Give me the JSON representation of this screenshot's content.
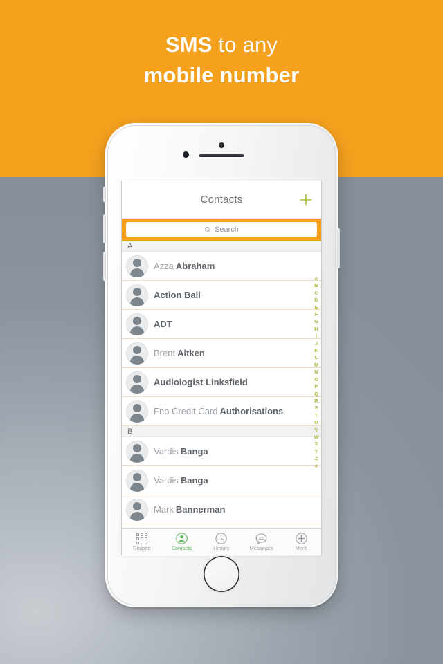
{
  "promo": {
    "line1_strong": "SMS",
    "line1_rest": " to any",
    "line2": "mobile number",
    "band_color": "#f5a11e",
    "text_color": "#ffffff"
  },
  "device": {
    "type": "white-smartphone",
    "camera_icon": "front-camera",
    "earpiece_icon": "earpiece-speaker",
    "sensor_icon": "proximity-sensor",
    "home_button_icon": "home-button"
  },
  "app": {
    "navbar": {
      "title": "Contacts",
      "add_icon": "plus-icon",
      "add_icon_color": "#aec043"
    },
    "search": {
      "placeholder": "Search",
      "value": "",
      "icon": "search-icon",
      "highlight_color": "#f5a11e"
    },
    "sections": [
      {
        "letter": "A",
        "contacts": [
          {
            "first": "Azza",
            "last": "Abraham",
            "avatar_icon": "person-avatar"
          },
          {
            "first": "",
            "last": "Action Ball",
            "avatar_icon": "person-avatar"
          },
          {
            "first": "",
            "last": "ADT",
            "avatar_icon": "person-avatar"
          },
          {
            "first": "Brent",
            "last": "Aitken",
            "avatar_icon": "person-avatar"
          },
          {
            "first": "",
            "last": "Audiologist Linksfield",
            "avatar_icon": "person-avatar"
          },
          {
            "first": "Fnb Credit Card",
            "last": "Authorisations",
            "avatar_icon": "person-avatar"
          }
        ]
      },
      {
        "letter": "B",
        "contacts": [
          {
            "first": "Vardis",
            "last": "Banga",
            "avatar_icon": "person-avatar"
          },
          {
            "first": "Vardis",
            "last": "Banga",
            "avatar_icon": "person-avatar"
          },
          {
            "first": "Mark",
            "last": "Bannerman",
            "avatar_icon": "person-avatar"
          }
        ]
      }
    ],
    "alpha_index": [
      "A",
      "B",
      "C",
      "D",
      "E",
      "F",
      "G",
      "H",
      "I",
      "J",
      "K",
      "L",
      "M",
      "N",
      "O",
      "P",
      "Q",
      "R",
      "S",
      "T",
      "U",
      "V",
      "W",
      "X",
      "Y",
      "Z",
      "#"
    ],
    "alpha_index_color": "#aec043",
    "tabs": [
      {
        "label": "Dialpad",
        "icon": "dialpad-icon",
        "active": false
      },
      {
        "label": "Contacts",
        "icon": "contacts-icon",
        "active": true
      },
      {
        "label": "History",
        "icon": "clock-icon",
        "active": false
      },
      {
        "label": "Messages",
        "icon": "message-icon",
        "active": false
      },
      {
        "label": "More",
        "icon": "plus-circle-icon",
        "active": false
      }
    ],
    "active_tab_color": "#5cb85c",
    "inactive_tab_color": "#9aa0a6"
  }
}
